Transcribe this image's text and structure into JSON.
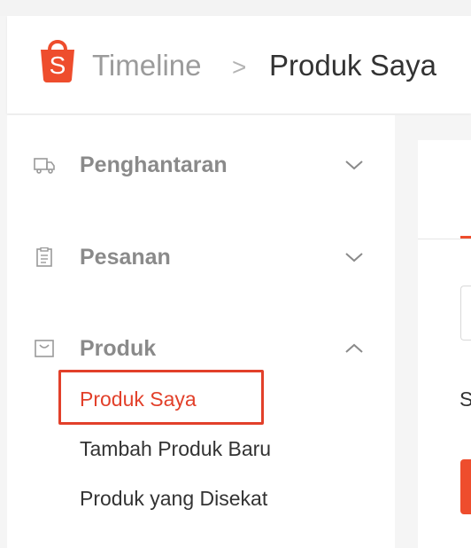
{
  "header": {
    "brand": "Timeline",
    "separator": ">",
    "current_page": "Produk Saya"
  },
  "sidebar": {
    "groups": [
      {
        "label": "Penghantaran",
        "icon": "truck-icon",
        "expanded": false
      },
      {
        "label": "Pesanan",
        "icon": "clipboard-icon",
        "expanded": false
      },
      {
        "label": "Produk",
        "icon": "bag-icon",
        "expanded": true,
        "items": [
          {
            "label": "Produk Saya",
            "active": true
          },
          {
            "label": "Tambah Produk Baru",
            "active": false
          },
          {
            "label": "Produk yang Disekat",
            "active": false
          }
        ]
      }
    ]
  },
  "main": {
    "partial_text": "S"
  },
  "colors": {
    "accent": "#ee4d2d",
    "active_text": "#e2402a",
    "muted": "#8a8a8a"
  }
}
